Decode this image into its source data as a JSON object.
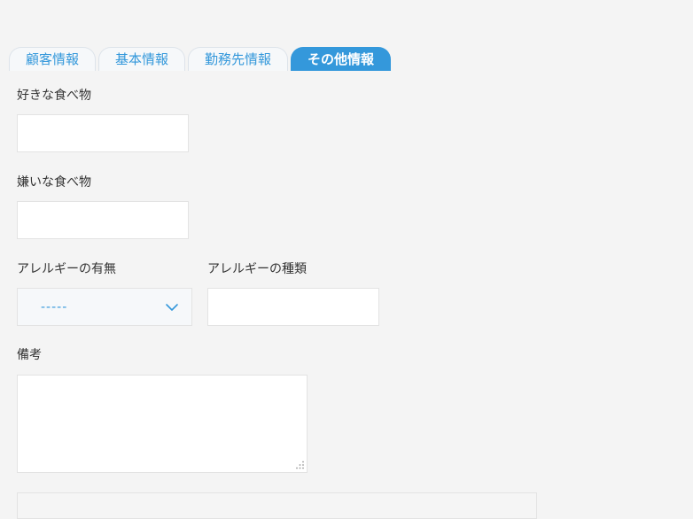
{
  "tabs": [
    {
      "label": "顧客情報",
      "active": false
    },
    {
      "label": "基本情報",
      "active": false
    },
    {
      "label": "勤務先情報",
      "active": false
    },
    {
      "label": "その他情報",
      "active": true
    }
  ],
  "form": {
    "favorite_food": {
      "label": "好きな食べ物",
      "value": ""
    },
    "disliked_food": {
      "label": "嫌いな食べ物",
      "value": ""
    },
    "allergy_presence": {
      "label": "アレルギーの有無",
      "selected": "-----"
    },
    "allergy_type": {
      "label": "アレルギーの種類",
      "value": ""
    },
    "notes": {
      "label": "備考",
      "value": ""
    }
  },
  "colors": {
    "accent": "#3498db",
    "background": "#f4f4f4",
    "field_border": "#e3e3e3"
  },
  "icons": {
    "select_arrow": "chevron-down-icon",
    "textarea_resize": "resize-grip-icon"
  }
}
